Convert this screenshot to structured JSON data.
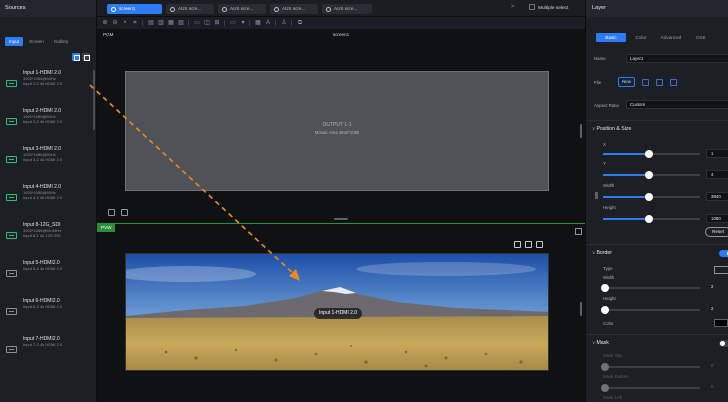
{
  "sources": {
    "title": "Sources",
    "tabs": [
      "Input",
      "Screen",
      "Gallery"
    ],
    "active_tab": "Input",
    "items": [
      {
        "name": "Input 1-HDMI 2.0",
        "res": "1920*1080@60Hz",
        "sub": "Input 1-2 4k HDMI 2.0",
        "color": "#27c27a"
      },
      {
        "name": "Input 2-HDMI 2.0",
        "res": "1920*1080@60Hz",
        "sub": "Input 2-2 4k HDMI 2.0",
        "color": "#27c27a"
      },
      {
        "name": "Input 3-HDMI 2.0",
        "res": "1920*1080@60Hz",
        "sub": "Input 3-2 4k HDMI 2.0",
        "color": "#27c27a"
      },
      {
        "name": "Input 4-HDMI 2.0",
        "res": "1920*1080@60Hz",
        "sub": "Input 4-2 4k HDMI 2.0",
        "color": "#27c27a"
      },
      {
        "name": "Input 8-12G_SDI",
        "res": "1920*1080@59.94Hz",
        "sub": "Input 8-1 4k 12G SDI",
        "color": "#27c27a"
      },
      {
        "name": "Input 5-HDMI2.0",
        "res": "",
        "sub": "Input 5-2 4k HDMI 2.0",
        "color": "#8a9099"
      },
      {
        "name": "Input 6-HDMI2.0",
        "res": "",
        "sub": "Input 6-2 4k HDMI 2.0",
        "color": "#8a9099"
      },
      {
        "name": "Input 7-HDMI2.0",
        "res": "",
        "sub": "Input 7-2 4k HDMI 2.0",
        "color": "#8a9099"
      }
    ]
  },
  "topbar": {
    "tabs": [
      {
        "label": "screen1",
        "active": true
      },
      {
        "label": "AUX scre...",
        "active": false
      },
      {
        "label": "AUX scre...",
        "active": false
      },
      {
        "label": "AUX scre...",
        "active": false
      },
      {
        "label": "AUX scre...",
        "active": false
      }
    ],
    "close_glyph": "×",
    "more_glyph": ">",
    "multiple_select_label": "Multiple select"
  },
  "pgm": {
    "label": "PGM",
    "screen_name": "screen1",
    "output_title": "OUTPUT 1-1",
    "output_sub": "Mosaic Area 3840*1080"
  },
  "pvw": {
    "label": "PVW",
    "layer_badge": "Input 1-HDMI 2.0"
  },
  "layer": {
    "title": "Layer",
    "tabs": [
      "Basic",
      "Color",
      "Advanced",
      "DSK"
    ],
    "active_tab": "Basic",
    "name_label": "Name",
    "name_value": "Layer1",
    "file_label": "File",
    "new_label": "New",
    "aspect_label": "Aspect Ratio",
    "aspect_value": "Custom",
    "pos_section": "Position & Size",
    "x_label": "X",
    "x_value": "1",
    "y_label": "Y",
    "y_value": "4",
    "width_label": "Width",
    "width_value": "3840",
    "height_label": "Height",
    "height_value": "1080",
    "reset_label": "Reset",
    "border_section": "Border",
    "border_on": true,
    "type_label": "Type",
    "bwidth_label": "Width",
    "bwidth_value": "2",
    "bheight_label": "Height",
    "bheight_value": "2",
    "color_label": "Color",
    "color_value": "#000000",
    "mask_section": "Mask",
    "mask_on": false,
    "mask_top_label": "Mask Top",
    "mask_top_value": "0",
    "mask_bottom_label": "Mask Bottom",
    "mask_bottom_value": "0",
    "mask_left_label": "Mask Left",
    "accent": "#2e7bf6",
    "pvw_color": "#2b8f3a",
    "drag_color": "#f08a1c"
  }
}
